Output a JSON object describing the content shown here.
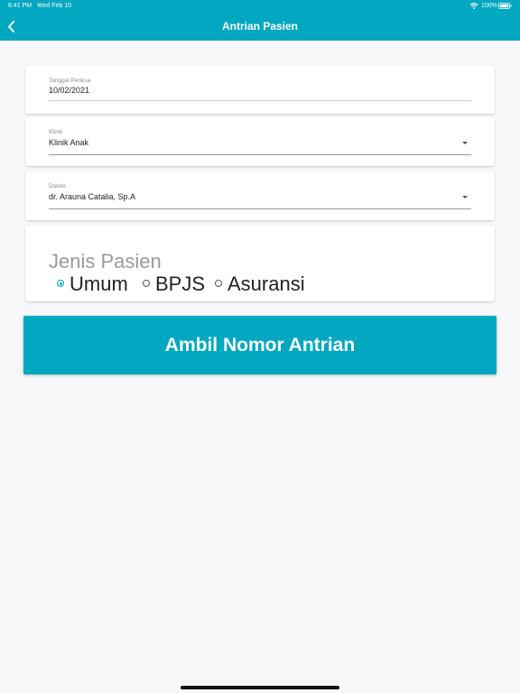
{
  "status_bar": {
    "time": "6:41 PM",
    "date": "Wed Feb 10",
    "battery": "100%"
  },
  "nav": {
    "title": "Antrian Pasien",
    "back_icon": "chevron-left-icon"
  },
  "form": {
    "tanggal": {
      "label": "Tanggal Periksa",
      "value": "10/02/2021"
    },
    "klinik": {
      "label": "Klinik",
      "value": "Klinik Anak"
    },
    "dokter": {
      "label": "Dokter",
      "value": "dr. Arauna Catalia, Sp.A"
    },
    "jenis_pasien": {
      "label": "Jenis Pasien",
      "options": [
        "Umum",
        "BPJS",
        "Asuransi"
      ],
      "selected": "Umum"
    }
  },
  "submit_label": "Ambil Nomor Antrian",
  "colors": {
    "accent": "#00a7c0",
    "background": "#f6f7f8"
  }
}
